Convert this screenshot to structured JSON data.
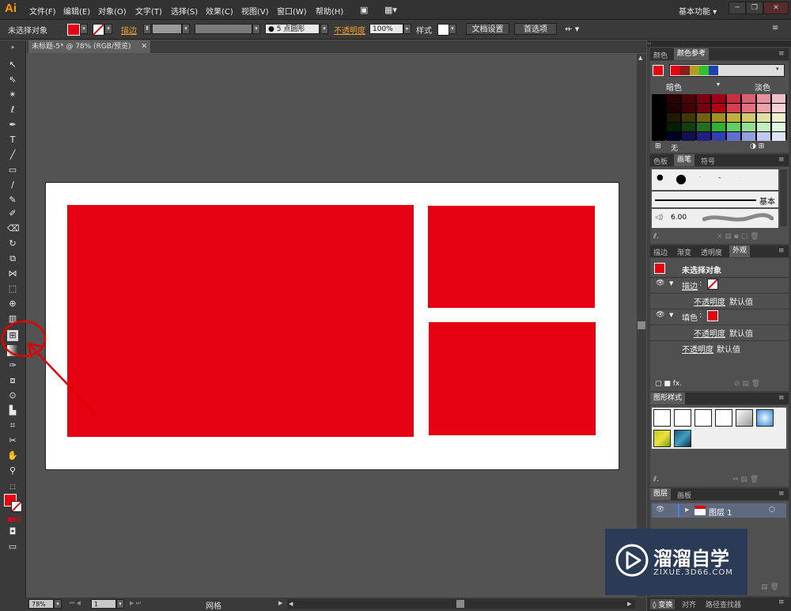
{
  "app": {
    "logo": "Ai",
    "workspace": "基本功能"
  },
  "menu": [
    "文件(F)",
    "编辑(E)",
    "对象(O)",
    "文字(T)",
    "选择(S)",
    "效果(C)",
    "视图(V)",
    "窗口(W)",
    "帮助(H)"
  ],
  "control": {
    "selection": "未选择对象",
    "stroke_label": "描边",
    "brush_size": "5 点圆形",
    "opacity_label": "不透明度",
    "opacity_value": "100%",
    "style_label": "样式",
    "doc_setup": "文档设置",
    "prefs": "首选项"
  },
  "document": {
    "tab": "未标题-5* @ 78% (RGB/预览)"
  },
  "status": {
    "zoom": "78%",
    "page": "1",
    "tool_name": "网格"
  },
  "colors": {
    "accent": "#e50012",
    "artboard": "#ffffff",
    "background": "#535353",
    "annotation": "#e00000"
  },
  "panels": {
    "color_tabs": [
      "颜色",
      "颜色参考"
    ],
    "color_guide": {
      "dark_label": "暗色",
      "light_label": "淡色",
      "none_label": "无"
    },
    "brush_tabs": [
      "色板",
      "画笔",
      "符号"
    ],
    "brush": {
      "basic": "基本",
      "size": "6.00"
    },
    "appearance_tabs": [
      "描边",
      "渐变",
      "透明度",
      "外观"
    ],
    "appearance": {
      "title": "未选择对象",
      "stroke": "描边",
      "opacity1": "不透明度",
      "default1": "默认值",
      "fill": "填色",
      "opacity2": "不透明度",
      "default2": "默认值",
      "opacity3": "不透明度",
      "default3": "默认值"
    },
    "graphic_styles_tab": "图形样式",
    "layers_tabs": [
      "图层",
      "画板"
    ],
    "layer_name": "图层 1",
    "bottom_tabs": [
      "变换",
      "对齐",
      "路径查找器"
    ]
  },
  "watermark": {
    "title": "溜溜自学",
    "subtitle": "ZIXUE.3D66.COM"
  }
}
